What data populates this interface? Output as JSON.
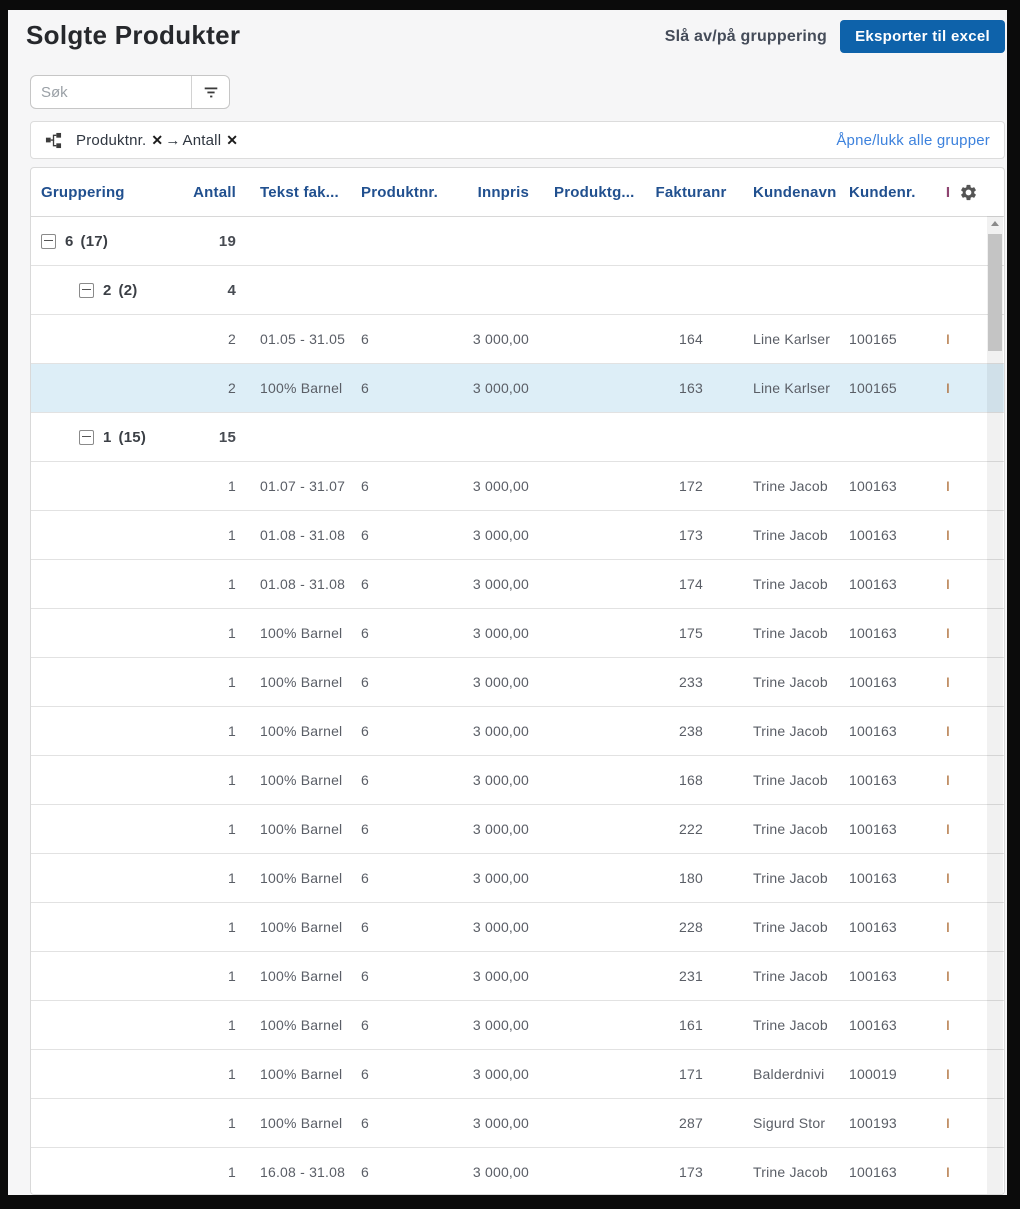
{
  "page": {
    "title": "Solgte Produkter",
    "toggle_grouping_label": "Slå av/på gruppering",
    "export_button_label": "Eksporter til excel"
  },
  "search": {
    "placeholder": "Søk"
  },
  "grouping_bar": {
    "chips": [
      {
        "label": "Produktnr."
      },
      {
        "label": "Antall"
      }
    ],
    "remove_icon": "✕",
    "arrow": "→",
    "toggle_all_label": "Åpne/lukk alle grupper"
  },
  "table": {
    "columns": [
      "Gruppering",
      "Antall",
      "Tekst fak...",
      "Produktnr.",
      "Innpris",
      "Produktg...",
      "Fakturanr",
      "Kundenavn",
      "Kundenr.",
      "I"
    ],
    "rows": [
      {
        "type": "group",
        "level": 1,
        "value": "6",
        "count": "(17)",
        "antall": "19"
      },
      {
        "type": "group",
        "level": 2,
        "value": "2",
        "count": "(2)",
        "antall": "4"
      },
      {
        "type": "data",
        "antall": "2",
        "tekst": "01.05 - 31.05",
        "produktnr": "6",
        "innpris": "3 000,00",
        "produktgruppe": "",
        "fakturanr": "164",
        "kundenavn": "Line Karlser",
        "kundenr": "100165",
        "extra": "I",
        "highlighted": false
      },
      {
        "type": "data",
        "antall": "2",
        "tekst": "100% Barnel",
        "produktnr": "6",
        "innpris": "3 000,00",
        "produktgruppe": "",
        "fakturanr": "163",
        "kundenavn": "Line Karlser",
        "kundenr": "100165",
        "extra": "I",
        "highlighted": true
      },
      {
        "type": "group",
        "level": 2,
        "value": "1",
        "count": "(15)",
        "antall": "15"
      },
      {
        "type": "data",
        "antall": "1",
        "tekst": "01.07 - 31.07",
        "produktnr": "6",
        "innpris": "3 000,00",
        "produktgruppe": "",
        "fakturanr": "172",
        "kundenavn": "Trine Jacob",
        "kundenr": "100163",
        "extra": "I",
        "highlighted": false
      },
      {
        "type": "data",
        "antall": "1",
        "tekst": "01.08 - 31.08",
        "produktnr": "6",
        "innpris": "3 000,00",
        "produktgruppe": "",
        "fakturanr": "173",
        "kundenavn": "Trine Jacob",
        "kundenr": "100163",
        "extra": "I",
        "highlighted": false
      },
      {
        "type": "data",
        "antall": "1",
        "tekst": "01.08 - 31.08",
        "produktnr": "6",
        "innpris": "3 000,00",
        "produktgruppe": "",
        "fakturanr": "174",
        "kundenavn": "Trine Jacob",
        "kundenr": "100163",
        "extra": "I",
        "highlighted": false
      },
      {
        "type": "data",
        "antall": "1",
        "tekst": "100% Barnel",
        "produktnr": "6",
        "innpris": "3 000,00",
        "produktgruppe": "",
        "fakturanr": "175",
        "kundenavn": "Trine Jacob",
        "kundenr": "100163",
        "extra": "I",
        "highlighted": false
      },
      {
        "type": "data",
        "antall": "1",
        "tekst": "100% Barnel",
        "produktnr": "6",
        "innpris": "3 000,00",
        "produktgruppe": "",
        "fakturanr": "233",
        "kundenavn": "Trine Jacob",
        "kundenr": "100163",
        "extra": "I",
        "highlighted": false
      },
      {
        "type": "data",
        "antall": "1",
        "tekst": "100% Barnel",
        "produktnr": "6",
        "innpris": "3 000,00",
        "produktgruppe": "",
        "fakturanr": "238",
        "kundenavn": "Trine Jacob",
        "kundenr": "100163",
        "extra": "I",
        "highlighted": false
      },
      {
        "type": "data",
        "antall": "1",
        "tekst": "100% Barnel",
        "produktnr": "6",
        "innpris": "3 000,00",
        "produktgruppe": "",
        "fakturanr": "168",
        "kundenavn": "Trine Jacob",
        "kundenr": "100163",
        "extra": "I",
        "highlighted": false
      },
      {
        "type": "data",
        "antall": "1",
        "tekst": "100% Barnel",
        "produktnr": "6",
        "innpris": "3 000,00",
        "produktgruppe": "",
        "fakturanr": "222",
        "kundenavn": "Trine Jacob",
        "kundenr": "100163",
        "extra": "I",
        "highlighted": false
      },
      {
        "type": "data",
        "antall": "1",
        "tekst": "100% Barnel",
        "produktnr": "6",
        "innpris": "3 000,00",
        "produktgruppe": "",
        "fakturanr": "180",
        "kundenavn": "Trine Jacob",
        "kundenr": "100163",
        "extra": "I",
        "highlighted": false
      },
      {
        "type": "data",
        "antall": "1",
        "tekst": "100% Barnel",
        "produktnr": "6",
        "innpris": "3 000,00",
        "produktgruppe": "",
        "fakturanr": "228",
        "kundenavn": "Trine Jacob",
        "kundenr": "100163",
        "extra": "I",
        "highlighted": false
      },
      {
        "type": "data",
        "antall": "1",
        "tekst": "100% Barnel",
        "produktnr": "6",
        "innpris": "3 000,00",
        "produktgruppe": "",
        "fakturanr": "231",
        "kundenavn": "Trine Jacob",
        "kundenr": "100163",
        "extra": "I",
        "highlighted": false
      },
      {
        "type": "data",
        "antall": "1",
        "tekst": "100% Barnel",
        "produktnr": "6",
        "innpris": "3 000,00",
        "produktgruppe": "",
        "fakturanr": "161",
        "kundenavn": "Trine Jacob",
        "kundenr": "100163",
        "extra": "I",
        "highlighted": false
      },
      {
        "type": "data",
        "antall": "1",
        "tekst": "100% Barnel",
        "produktnr": "6",
        "innpris": "3 000,00",
        "produktgruppe": "",
        "fakturanr": "171",
        "kundenavn": "Balderdnivi",
        "kundenr": "100019",
        "extra": "I",
        "highlighted": false
      },
      {
        "type": "data",
        "antall": "1",
        "tekst": "100% Barnel",
        "produktnr": "6",
        "innpris": "3 000,00",
        "produktgruppe": "",
        "fakturanr": "287",
        "kundenavn": "Sigurd Stor",
        "kundenr": "100193",
        "extra": "I",
        "highlighted": false
      },
      {
        "type": "data",
        "antall": "1",
        "tekst": "16.08 - 31.08",
        "produktnr": "6",
        "innpris": "3 000,00",
        "produktgruppe": "",
        "fakturanr": "173",
        "kundenavn": "Trine Jacob",
        "kundenr": "100163",
        "extra": "I",
        "highlighted": false
      }
    ]
  },
  "colors": {
    "accent_blue": "#0e62aa",
    "link_blue": "#3d82dd",
    "header_blue": "#21508f",
    "highlight_row": "#ddeef7",
    "row_i_marker": "#a9652c",
    "header_i_marker": "#8e4470"
  }
}
